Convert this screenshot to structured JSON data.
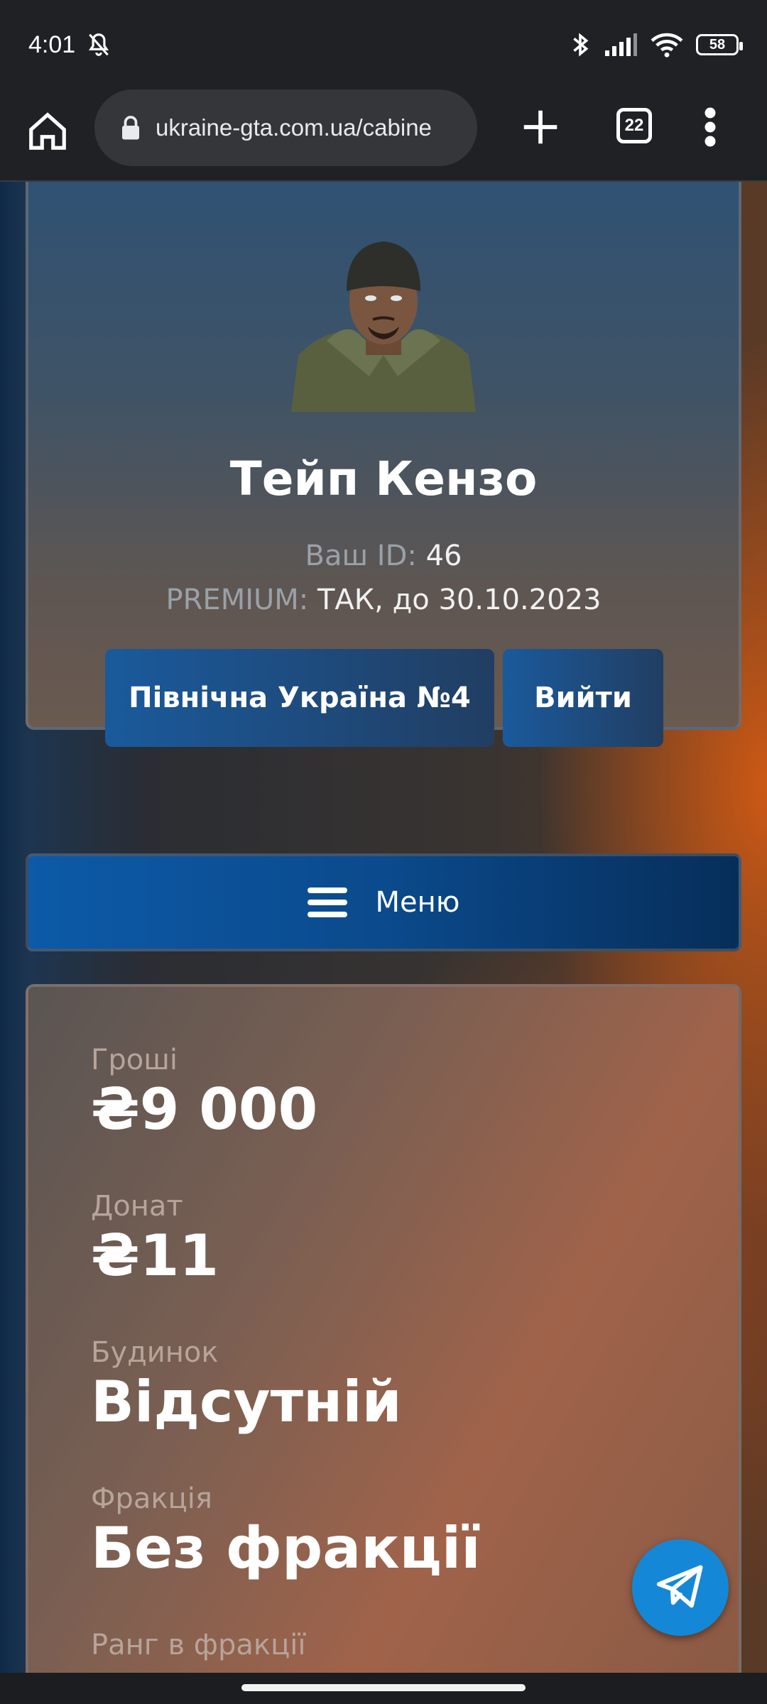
{
  "status_bar": {
    "time": "4:01",
    "battery": "58"
  },
  "browser": {
    "url": "ukraine-gta.com.ua/cabine",
    "tab_count": "22"
  },
  "profile": {
    "name": "Тейп Кензо",
    "id_label": "Ваш ID:",
    "id_value": "46",
    "premium_label": "PREMIUM:",
    "premium_value": "ТАК, до 30.10.2023",
    "server_button": "Північна Україна №4",
    "logout_button": "Вийти"
  },
  "menu": {
    "label": "Меню"
  },
  "stats": [
    {
      "label": "Гроші",
      "value": "₴9 000"
    },
    {
      "label": "Донат",
      "value": "₴11"
    },
    {
      "label": "Будинок",
      "value": "Відсутній"
    },
    {
      "label": "Фракція",
      "value": "Без фракції"
    },
    {
      "label": "Ранг в фракції",
      "value": ""
    }
  ],
  "colors": {
    "accent_blue": "#0c5aa8",
    "telegram_blue": "#1488d6",
    "bg_orange": "#d25a14"
  },
  "icons": {
    "home": "home-icon",
    "lock": "lock-icon",
    "new_tab": "plus-icon",
    "more": "more-vert-icon",
    "menu": "hamburger-icon",
    "telegram": "telegram-icon"
  }
}
